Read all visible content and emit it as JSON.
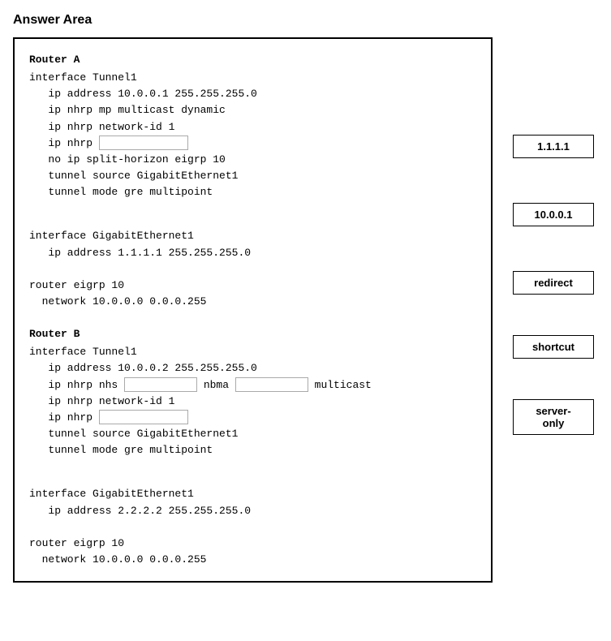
{
  "page": {
    "title": "Answer Area"
  },
  "answer_box": {
    "router_a_label": "Router A",
    "router_a_code_1": "interface Tunnel1\n   ip address 10.0.0.1 255.255.255.0\n   ip nhrp mp multicast dynamic\n   ip nhrp network-id 1\n   ip nhrp ",
    "router_a_input_placeholder": "",
    "router_a_code_2": "\n   no ip split-horizon eigrp 10\n   tunnel source GigabitEthernet1\n   tunnel mode gre multipoint",
    "router_a_code_3": "\ninterface GigabitEthernet1\n   ip address 1.1.1.1 255.255.255.0\n\nrouter eigrp 10\n  network 10.0.0.0 0.0.0.255",
    "router_b_label": "Router B",
    "router_b_code_1": "interface Tunnel1\n   ip address 10.0.0.2 255.255.255.0\n   ip nhrp nhs ",
    "router_b_nhs_placeholder": "",
    "router_b_nbma_label": " nbma ",
    "router_b_nbma_placeholder": "",
    "router_b_multicast_label": " multicast",
    "router_b_code_2": "\n   ip nhrp network-id 1\n   ip nhrp ",
    "router_b_input_placeholder": "",
    "router_b_code_3": "\n   tunnel source GigabitEthernet1\n   tunnel mode gre multipoint",
    "router_b_code_4": "\ninterface GigabitEthernet1\n   ip address 2.2.2.2 255.255.255.0\n\nrouter eigrp 10\n  network 10.0.0.0 0.0.0.255"
  },
  "sidebar": {
    "options": [
      {
        "id": "opt-1-1-1-1",
        "label": "1.1.1.1"
      },
      {
        "id": "opt-10-0-0-1",
        "label": "10.0.0.1"
      },
      {
        "id": "opt-redirect",
        "label": "redirect"
      },
      {
        "id": "opt-shortcut",
        "label": "shortcut"
      },
      {
        "id": "opt-server-only",
        "label": "server-only"
      }
    ]
  }
}
